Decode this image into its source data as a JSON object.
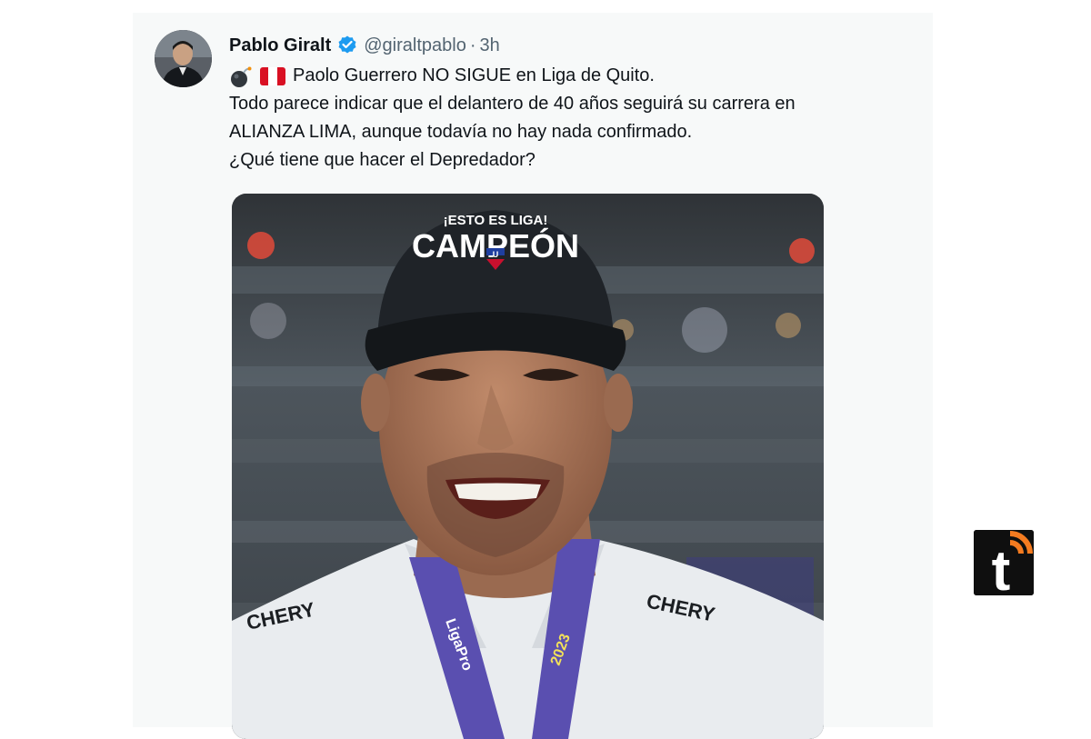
{
  "tweet": {
    "author_name": "Pablo Giralt",
    "handle": "@giraltpablo",
    "separator": "·",
    "time": "3h",
    "lines": [
      "Paolo Guerrero NO SIGUE en Liga de Quito.",
      "Todo parece indicar que el delantero de 40 años seguirá su carrera en",
      "ALIANZA LIMA, aunque todavía no hay nada confirmado.",
      "¿Qué tiene que hacer el Depredador?"
    ],
    "emoji_icons": [
      "bomb-icon",
      "peru-flag-icon"
    ]
  },
  "photo": {
    "cap_top_text": "¡ESTO ES LIGA!",
    "cap_main_text": "CAMPEÓN",
    "cap_badge_letter": "U",
    "sponsor_left": "CHERY",
    "sponsor_right": "CHERY",
    "medal_text": "LigaPro",
    "medal_year": "2023"
  },
  "watermark": {
    "letter": "t"
  },
  "colors": {
    "verified_blue": "#1d9bf0",
    "flag_red": "#d91023",
    "text_primary": "#0f1419",
    "text_secondary": "#536471",
    "logo_orange": "#f47b20"
  }
}
